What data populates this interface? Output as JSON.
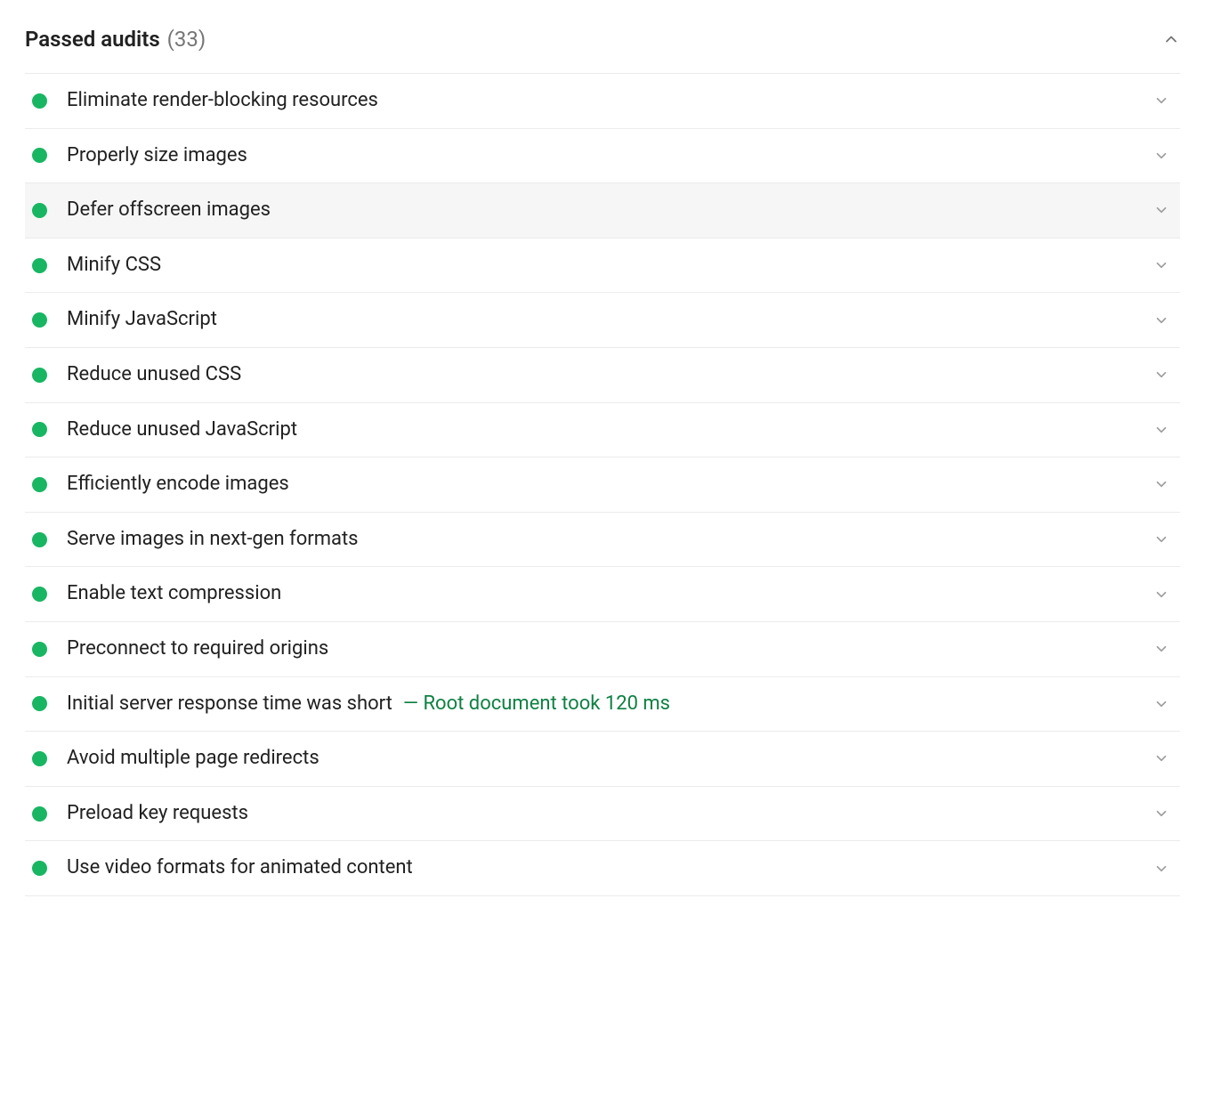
{
  "colors": {
    "pass": "#18b663",
    "detail": "#0e8043",
    "muted": "#757575",
    "text": "#212121",
    "border": "#ebebeb",
    "highlight": "#f6f6f6"
  },
  "section": {
    "title": "Passed audits",
    "count": "(33)"
  },
  "audits": [
    {
      "title": "Eliminate render-blocking resources",
      "detail": "",
      "highlighted": false
    },
    {
      "title": "Properly size images",
      "detail": "",
      "highlighted": false
    },
    {
      "title": "Defer offscreen images",
      "detail": "",
      "highlighted": true
    },
    {
      "title": "Minify CSS",
      "detail": "",
      "highlighted": false
    },
    {
      "title": "Minify JavaScript",
      "detail": "",
      "highlighted": false
    },
    {
      "title": "Reduce unused CSS",
      "detail": "",
      "highlighted": false
    },
    {
      "title": "Reduce unused JavaScript",
      "detail": "",
      "highlighted": false
    },
    {
      "title": "Efficiently encode images",
      "detail": "",
      "highlighted": false
    },
    {
      "title": "Serve images in next-gen formats",
      "detail": "",
      "highlighted": false
    },
    {
      "title": "Enable text compression",
      "detail": "",
      "highlighted": false
    },
    {
      "title": "Preconnect to required origins",
      "detail": "",
      "highlighted": false
    },
    {
      "title": "Initial server response time was short",
      "detail": "— Root document took 120 ms",
      "highlighted": false
    },
    {
      "title": "Avoid multiple page redirects",
      "detail": "",
      "highlighted": false
    },
    {
      "title": "Preload key requests",
      "detail": "",
      "highlighted": false
    },
    {
      "title": "Use video formats for animated content",
      "detail": "",
      "highlighted": false
    }
  ]
}
